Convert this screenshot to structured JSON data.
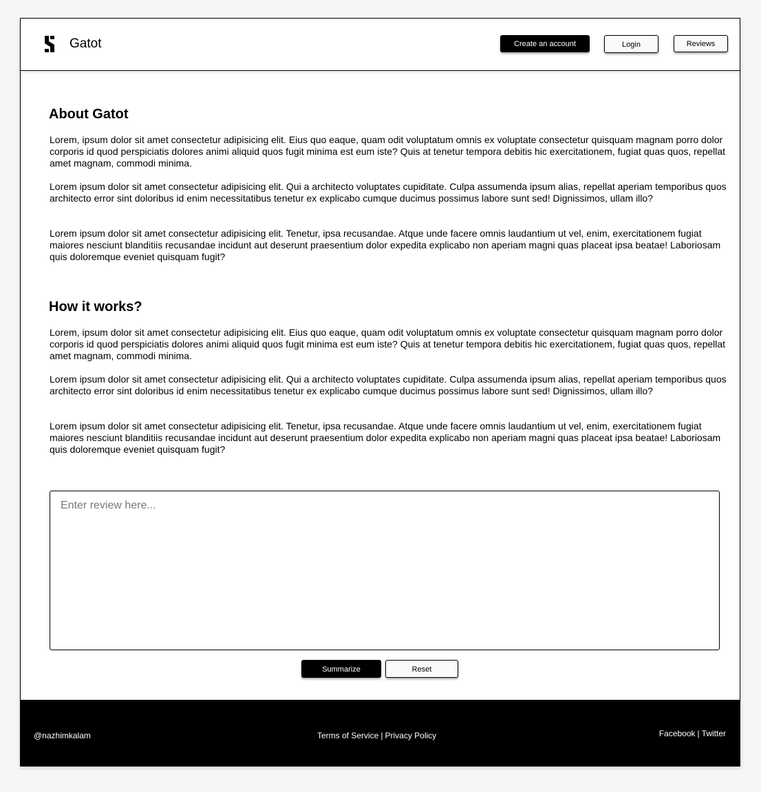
{
  "header": {
    "brand": "Gatot",
    "create_account_label": "Create an account",
    "login_label": "Login",
    "reviews_label": "Reviews"
  },
  "about": {
    "title": "About Gatot",
    "paragraphs": [
      "Lorem, ipsum dolor sit amet consectetur adipisicing elit. Eius quo eaque, quam odit voluptatum omnis ex voluptate consectetur quisquam magnam porro dolor corporis id quod perspiciatis dolores animi aliquid quos fugit minima est eum iste? Quis at tenetur tempora debitis hic exercitationem, fugiat quas quos, repellat amet magnam, commodi minima.",
      "Lorem ipsum dolor sit amet consectetur adipisicing elit. Qui a architecto voluptates cupiditate. Culpa assumenda ipsum alias, repellat aperiam temporibus quos architecto error sint doloribus id enim necessitatibus tenetur ex explicabo cumque ducimus possimus labore sunt sed! Dignissimos, ullam illo?",
      "Lorem ipsum dolor sit amet consectetur adipisicing elit. Tenetur, ipsa recusandae. Atque unde facere omnis laudantium ut vel, enim, exercitationem fugiat maiores nesciunt blanditiis recusandae incidunt aut deserunt praesentium dolor expedita explicabo non aperiam magni quas placeat ipsa beatae! Laboriosam quis doloremque eveniet quisquam fugit?"
    ]
  },
  "how": {
    "title": "How it works?",
    "paragraphs": [
      "Lorem, ipsum dolor sit amet consectetur adipisicing elit. Eius quo eaque, quam odit voluptatum omnis ex voluptate consectetur quisquam magnam porro dolor corporis id quod perspiciatis dolores animi aliquid quos fugit minima est eum iste? Quis at tenetur tempora debitis hic exercitationem, fugiat quas quos, repellat amet magnam, commodi minima.",
      "Lorem ipsum dolor sit amet consectetur adipisicing elit. Qui a architecto voluptates cupiditate. Culpa assumenda ipsum alias, repellat aperiam temporibus quos architecto error sint doloribus id enim necessitatibus tenetur ex explicabo cumque ducimus possimus labore sunt sed! Dignissimos, ullam illo?",
      "Lorem ipsum dolor sit amet consectetur adipisicing elit. Tenetur, ipsa recusandae. Atque unde facere omnis laudantium ut vel, enim, exercitationem fugiat maiores nesciunt blanditiis recusandae incidunt aut deserunt praesentium dolor expedita explicabo non aperiam magni quas placeat ipsa beatae! Laboriosam quis doloremque eveniet quisquam fugit?"
    ]
  },
  "review": {
    "placeholder": "Enter review here...",
    "value": "",
    "summarize_label": "Summarize",
    "reset_label": "Reset"
  },
  "footer": {
    "handle": "@nazhimkalam",
    "terms_label": "Terms of Service",
    "privacy_label": "Privacy Policy",
    "facebook_label": "Facebook",
    "twitter_label": "Twitter",
    "separator": "|"
  },
  "colors": {
    "primary": "#000000",
    "background": "#ffffff",
    "page_background": "#f6f6f6"
  },
  "icons": {
    "logo": "brand-logo-icon"
  }
}
